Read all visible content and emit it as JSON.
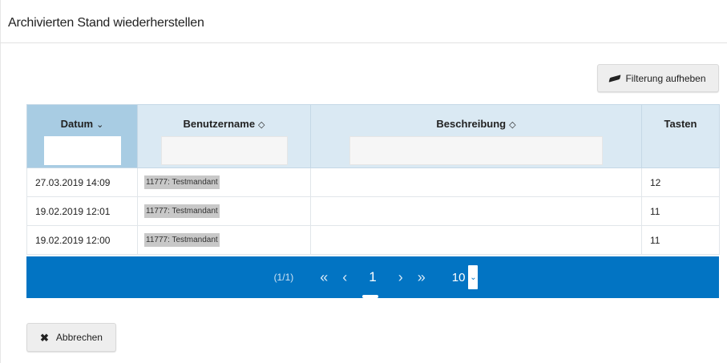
{
  "dialog": {
    "title": "Archivierten Stand wiederherstellen"
  },
  "toolbar": {
    "clear_filter_label": "Filterung aufheben"
  },
  "table": {
    "columns": [
      {
        "label": "Datum",
        "sort_icon": "chevron-down"
      },
      {
        "label": "Benutzername",
        "sort_icon": "sort-diamond"
      },
      {
        "label": "Beschreibung",
        "sort_icon": "sort-diamond"
      },
      {
        "label": "Tasten"
      }
    ],
    "rows": [
      {
        "datum": "27.03.2019 14:09",
        "benutzer": "11777: Testmandant",
        "beschreibung": "",
        "tasten": "12"
      },
      {
        "datum": "19.02.2019 12:01",
        "benutzer": "11777: Testmandant",
        "beschreibung": "",
        "tasten": "11"
      },
      {
        "datum": "19.02.2019 12:00",
        "benutzer": "11777: Testmandant",
        "beschreibung": "",
        "tasten": "11"
      }
    ]
  },
  "pagination": {
    "info": "(1/1)",
    "first": "«",
    "prev": "‹",
    "current_page": "1",
    "next": "›",
    "last": "»",
    "page_size": "10"
  },
  "footer": {
    "cancel_label": "Abbrechen"
  },
  "colors": {
    "accent": "#0274c3",
    "header_bg": "#dae9f3",
    "sorted_header_bg": "#a8cce3"
  }
}
